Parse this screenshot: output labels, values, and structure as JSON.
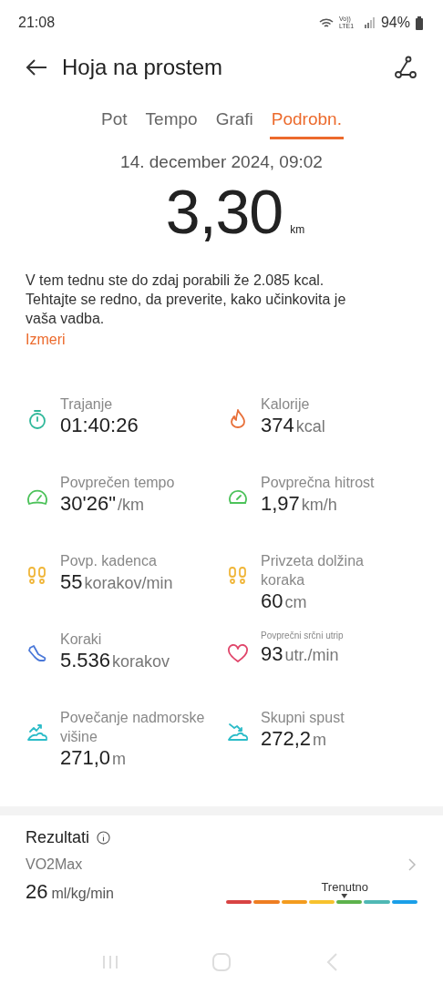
{
  "status_bar": {
    "time": "21:08",
    "network": "Vo)) LTE1",
    "battery": "94%"
  },
  "header": {
    "title": "Hoja na prostem"
  },
  "tabs": [
    {
      "label": "Pot",
      "selected": false
    },
    {
      "label": "Tempo",
      "selected": false
    },
    {
      "label": "Grafi",
      "selected": false
    },
    {
      "label": "Podrobn.",
      "selected": true
    }
  ],
  "date": "14. december 2024, 09:02",
  "distance": {
    "value": "3,30",
    "unit": "km"
  },
  "note": {
    "text": "V tem tednu ste do zdaj porabili že 2.085 kcal. Tehtajte se redno, da preverite, kako učinkovita je vaša vadba.",
    "link": "Izmeri"
  },
  "metrics": [
    {
      "kind": "timer",
      "color": "#2fb89a",
      "label": "Trajanje",
      "value": "01:40:26",
      "compact": false
    },
    {
      "kind": "flame",
      "color": "#e8703a",
      "label": "Kalorije",
      "value": "374",
      "unit": "kcal",
      "compact": false
    },
    {
      "kind": "gauge",
      "color": "#4cc25a",
      "label": "Povprečen tempo",
      "value": "30'26\"",
      "unit": "/km",
      "compact": false
    },
    {
      "kind": "speedometer",
      "color": "#4cc25a",
      "label": "Povprečna hitrost",
      "value": "1,97",
      "unit": "km/h",
      "compact": false
    },
    {
      "kind": "footprints",
      "color": "#f0b63a",
      "label": "Povp. kadenca",
      "value": "55",
      "unit": "korakov/min",
      "compact": false
    },
    {
      "kind": "footprints",
      "color": "#f0b63a",
      "label": "Privzeta dolžina koraka",
      "value": "60",
      "unit": "cm",
      "compact": false
    },
    {
      "kind": "shoe",
      "color": "#4a78d8",
      "label": "Koraki",
      "value": "5.536",
      "unit": "korakov",
      "compact": false
    },
    {
      "kind": "heart",
      "color": "#e0456a",
      "label": "Povprečni srčni utrip",
      "value": "93",
      "unit": "utr./min",
      "compact": true
    },
    {
      "kind": "ascent",
      "color": "#2cbcc8",
      "label": "Povečanje nadmorske višine",
      "value": "271,0",
      "unit": "m",
      "compact": false
    },
    {
      "kind": "descent",
      "color": "#2cbcc8",
      "label": "Skupni spust",
      "value": "272,2",
      "unit": "m",
      "compact": false
    }
  ],
  "results": {
    "title": "Rezultati",
    "name": "VO2Max",
    "value": "26",
    "unit": "ml/kg/min",
    "marker_label": "Trenutno",
    "scale": [
      {
        "color": "#d84343"
      },
      {
        "color": "#ee7d22"
      },
      {
        "color": "#f39c1f"
      },
      {
        "color": "#f7c22e"
      },
      {
        "color": "#5db24c"
      },
      {
        "color": "#4fb8b4"
      },
      {
        "color": "#1a9fe8"
      }
    ]
  }
}
